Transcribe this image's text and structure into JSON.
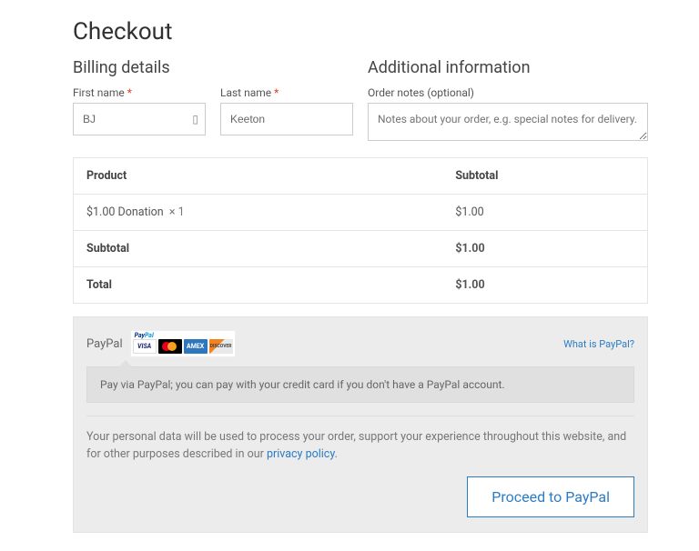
{
  "title": "Checkout",
  "billing": {
    "heading": "Billing details",
    "first_name_label": "First name",
    "last_name_label": "Last name",
    "required_marker": "*",
    "first_name_value": "BJ",
    "last_name_value": "Keeton"
  },
  "additional": {
    "heading": "Additional information",
    "notes_label": "Order notes (optional)",
    "notes_placeholder": "Notes about your order, e.g. special notes for delivery."
  },
  "order": {
    "headers": {
      "product": "Product",
      "subtotal": "Subtotal"
    },
    "rows": [
      {
        "name": "$1.00 Donation",
        "qty": "× 1",
        "amount": "$1.00"
      }
    ],
    "subtotal_label": "Subtotal",
    "subtotal_value": "$1.00",
    "total_label": "Total",
    "total_value": "$1.00"
  },
  "payment": {
    "method_label": "PayPal",
    "what_is": "What is PayPal?",
    "description": "Pay via PayPal; you can pay with your credit card if you don't have a PayPal account.",
    "cards": {
      "visa": "VISA",
      "amex": "AMEX",
      "discover": "DISCOVER"
    }
  },
  "privacy": {
    "text_a": "Your personal data will be used to process your order, support your experience throughout this website, and for other purposes described in our ",
    "link": "privacy policy",
    "text_b": "."
  },
  "button": {
    "proceed": "Proceed to PayPal"
  }
}
